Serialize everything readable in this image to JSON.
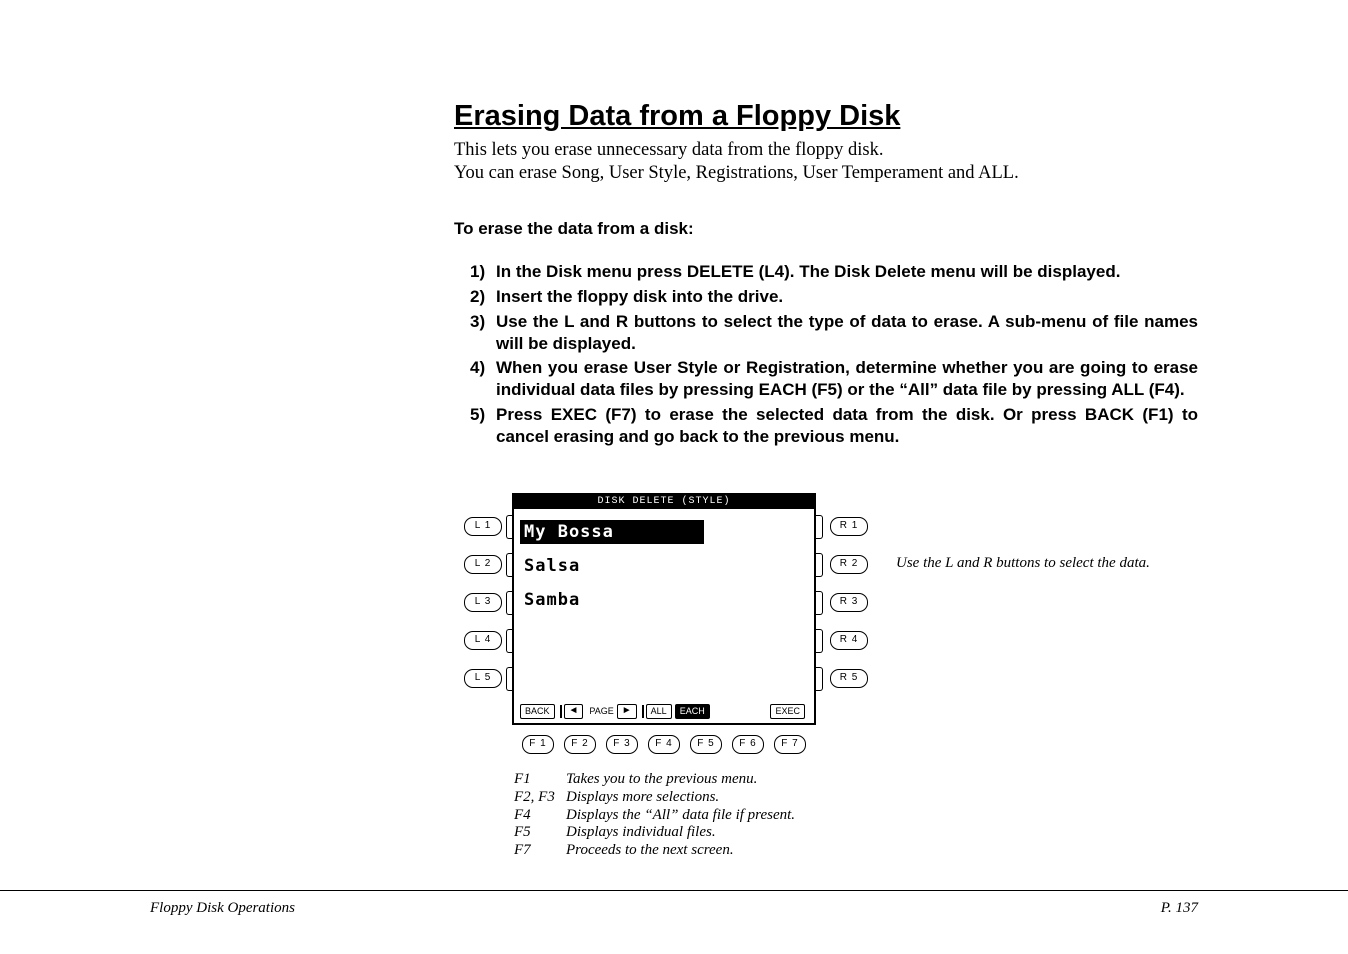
{
  "title": "Erasing Data from a Floppy Disk",
  "intro_line1": "This lets you erase unnecessary data from the floppy disk.",
  "intro_line2": "You can erase Song, User Style, Registrations, User Temperament and ALL.",
  "subhead": "To erase the data from a disk:",
  "steps": [
    {
      "n": "1)",
      "t": "In the Disk menu press DELETE (L4).  The Disk Delete menu will be displayed."
    },
    {
      "n": "2)",
      "t": "Insert the floppy disk into the drive."
    },
    {
      "n": "3)",
      "t": "Use the L and R buttons to select the type of data to erase.  A sub-menu of file names will be displayed."
    },
    {
      "n": "4)",
      "t": "When you erase User Style or Registration, determine whether you are going to erase individual data files by pressing EACH (F5) or the “All” data file by pressing ALL (F4)."
    },
    {
      "n": "5)",
      "t": "Press EXEC (F7) to erase the selected data from the disk.  Or press BACK (F1) to cancel erasing and go back to the previous menu."
    }
  ],
  "lcd": {
    "title": "DISK DELETE (STYLE)",
    "rows": [
      "My Bossa",
      "Salsa",
      "Samba",
      "",
      ""
    ],
    "selected_index": 0,
    "bottom": {
      "back": "BACK",
      "page": "PAGE",
      "all": "ALL",
      "each": "EACH",
      "exec": "EXEC"
    }
  },
  "side_buttons": {
    "L": [
      "L 1",
      "L 2",
      "L 3",
      "L 4",
      "L 5"
    ],
    "R": [
      "R 1",
      "R 2",
      "R 3",
      "R 4",
      "R 5"
    ],
    "F": [
      "F 1",
      "F 2",
      "F 3",
      "F 4",
      "F 5",
      "F 6",
      "F 7"
    ]
  },
  "side_note": "Use the L and R buttons to select the data.",
  "legend": [
    {
      "k": "F1",
      "d": "Takes you to the previous menu."
    },
    {
      "k": "F2, F3",
      "d": "Displays more selections."
    },
    {
      "k": "F4",
      "d": "Displays the “All” data file if present."
    },
    {
      "k": "F5",
      "d": "Displays individual files."
    },
    {
      "k": "F7",
      "d": "Proceeds to the next screen."
    }
  ],
  "footer": {
    "left": "Floppy Disk Operations",
    "right": "P. 137"
  }
}
